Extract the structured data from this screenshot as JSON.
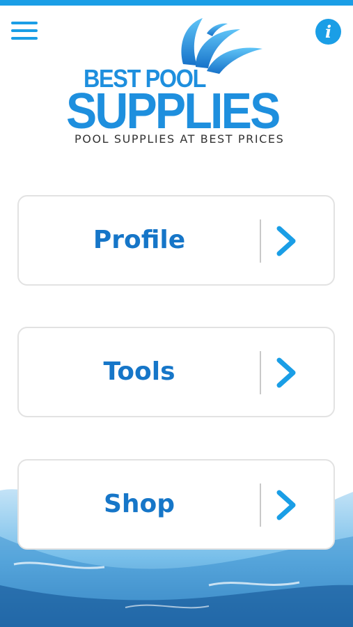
{
  "header": {
    "menu_icon": "hamburger-menu-icon",
    "info_icon": "info-icon",
    "info_glyph": "i",
    "accent_color": "#1a9ee6"
  },
  "logo": {
    "line1": "BEST POOL",
    "line2": "SUPPLIES",
    "tagline": "POOL SUPPLIES AT BEST PRICES",
    "color": "#1e8fde"
  },
  "menu": {
    "items": [
      {
        "label": "Profile",
        "icon": "chevron-right-icon"
      },
      {
        "label": "Tools",
        "icon": "chevron-right-icon"
      },
      {
        "label": "Shop",
        "icon": "chevron-right-icon"
      }
    ],
    "label_color": "#1676c8"
  }
}
